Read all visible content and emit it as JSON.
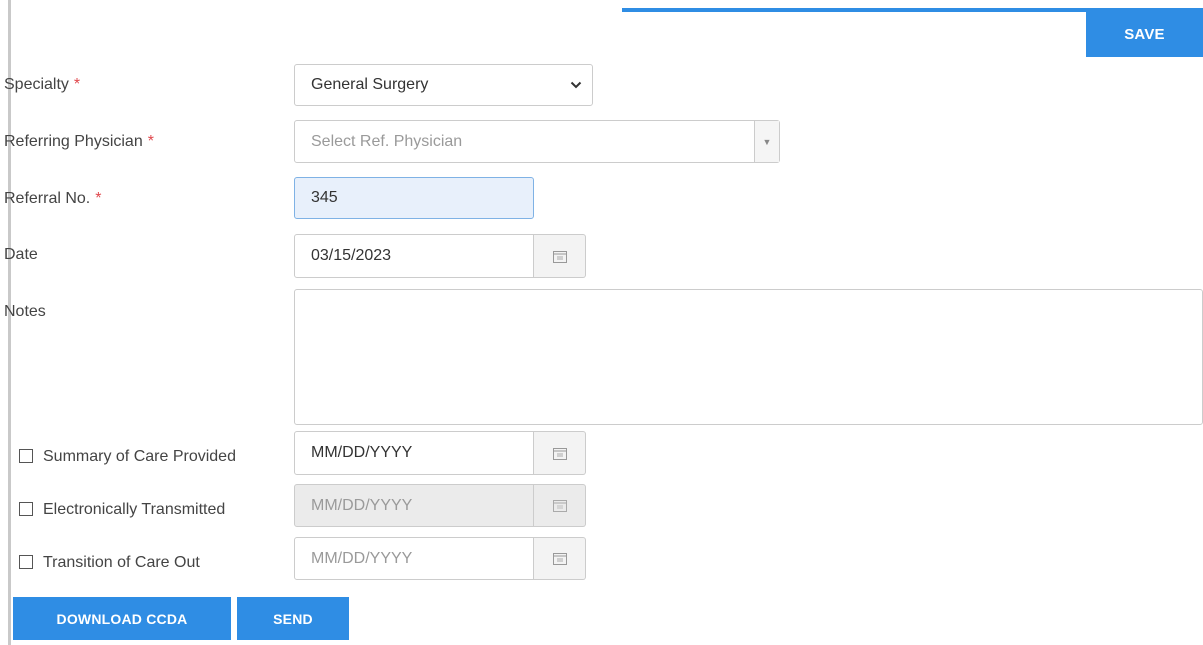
{
  "header": {
    "save_label": "SAVE"
  },
  "form": {
    "specialty": {
      "label": "Specialty",
      "value": "General Surgery"
    },
    "referring_physician": {
      "label": "Referring Physician",
      "placeholder": "Select Ref. Physician"
    },
    "referral_no": {
      "label": "Referral No.",
      "value": "345"
    },
    "date": {
      "label": "Date",
      "value": "03/15/2023"
    },
    "notes": {
      "label": "Notes",
      "value": ""
    },
    "required_marker": "*"
  },
  "checks": [
    {
      "label": "Summary of Care Provided",
      "checked": false,
      "date_placeholder": "MM/DD/YYYY",
      "disabled": false
    },
    {
      "label": "Electronically Transmitted",
      "checked": false,
      "date_placeholder": "MM/DD/YYYY",
      "disabled": true
    },
    {
      "label": "Transition of Care Out",
      "checked": false,
      "date_placeholder": "MM/DD/YYYY",
      "disabled": false
    }
  ],
  "footer": {
    "download_label": "DOWNLOAD CCDA",
    "send_label": "SEND"
  },
  "colors": {
    "accent": "#2f8de4",
    "required": "#e0474c",
    "active_input_bg": "#e8f0fb"
  },
  "icons": {
    "calendar": "calendar-icon",
    "select_caret": "chevron-down-icon",
    "dropdown_caret": "caret-down-icon"
  }
}
